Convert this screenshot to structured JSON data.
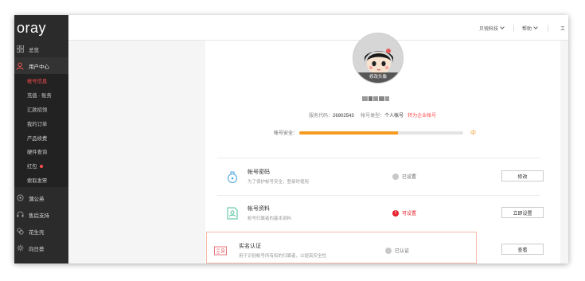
{
  "brand": {
    "logo": "oray"
  },
  "header": {
    "company": "贝锐科技",
    "help": "帮助",
    "workbench": "工"
  },
  "sidebar": {
    "overview": "总览",
    "user_center": "用户中心",
    "sub_items": [
      {
        "label": "帐号信息",
        "active": true,
        "badge": false
      },
      {
        "label": "充值 · 账务",
        "active": false,
        "badge": false
      },
      {
        "label": "汇款招领",
        "active": false,
        "badge": false
      },
      {
        "label": "我的订单",
        "active": false,
        "badge": false
      },
      {
        "label": "产品续费",
        "active": false,
        "badge": false
      },
      {
        "label": "硬件查询",
        "active": false,
        "badge": false
      },
      {
        "label": "红包",
        "active": false,
        "badge": true
      },
      {
        "label": "索取发票",
        "active": false,
        "badge": false
      }
    ],
    "bottom_items": [
      {
        "label": "蒲公英",
        "icon": "dandelion-icon"
      },
      {
        "label": "售后支持",
        "icon": "headset-icon"
      },
      {
        "label": "花生壳",
        "icon": "peanut-icon"
      },
      {
        "label": "向日葵",
        "icon": "sunflower-icon"
      }
    ]
  },
  "profile": {
    "avatar_caption": "修改头像",
    "service_code_label": "服务代码：",
    "service_code": "26902543",
    "account_type_label": "帐号类型：",
    "account_type": "个人帐号",
    "upgrade_link": "转为企业帐号",
    "security_label": "帐号安全：",
    "security_level": 0.6,
    "security_tip": "中"
  },
  "rows": [
    {
      "title": "帐号密码",
      "desc": "为了保护帐号安全，登录时使用",
      "status": "已设置",
      "status_type": "ok",
      "button": "修改",
      "icon": "lock-icon"
    },
    {
      "title": "帐号资料",
      "desc": "帐号归属者的基本资料",
      "status": "可设置",
      "status_type": "warn",
      "button": "立即设置",
      "icon": "profile-card-icon"
    },
    {
      "title": "实名认证",
      "desc": "用于识别帐号所有权的归属者，以提高安全性",
      "status": "已认证",
      "status_type": "ok",
      "button": "查看",
      "icon": "id-card-icon"
    }
  ],
  "colors": {
    "accent": "#ff4d4f",
    "progress": "#f59a23",
    "sidebar": "#2b2b2b"
  }
}
